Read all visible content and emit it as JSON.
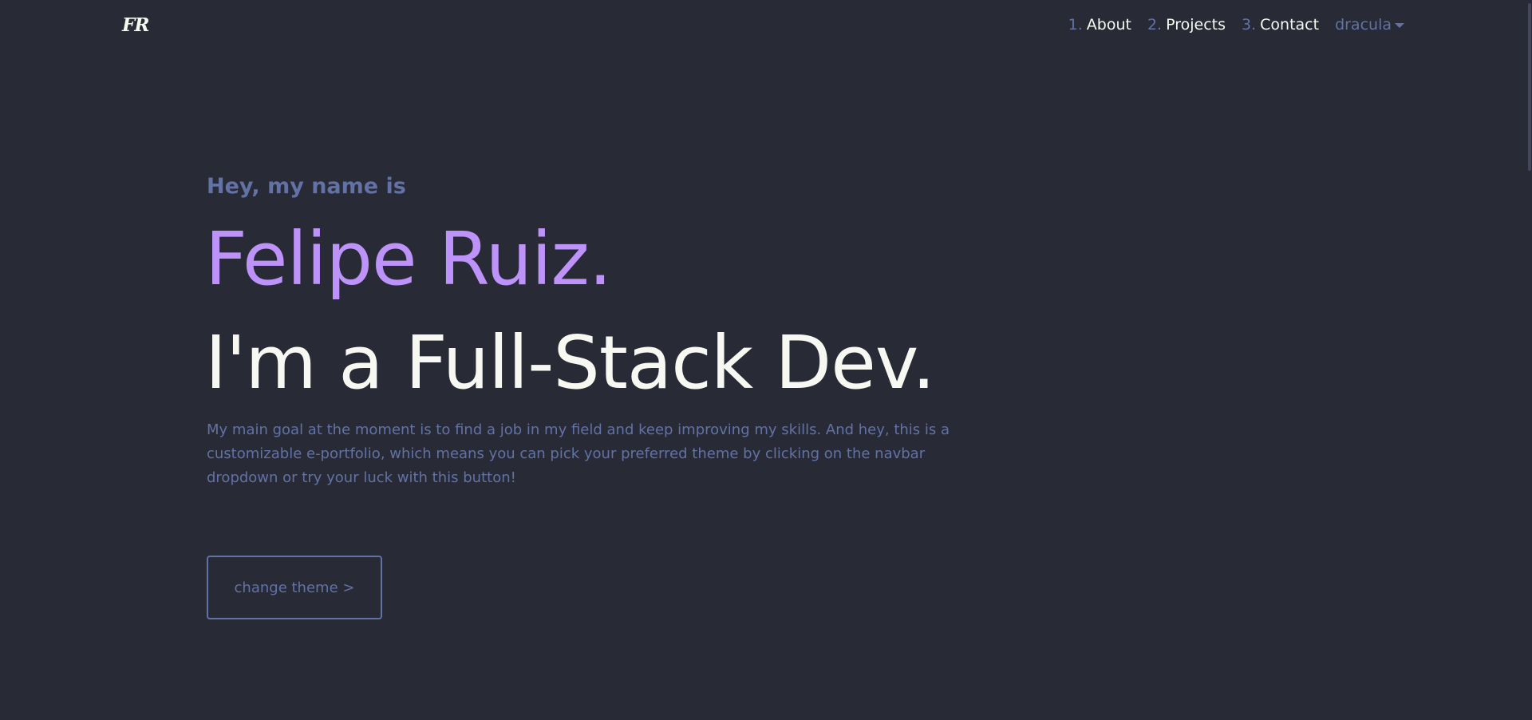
{
  "navbar": {
    "logo": "FR",
    "items": [
      {
        "num": "1.",
        "label": "About"
      },
      {
        "num": "2.",
        "label": "Projects"
      },
      {
        "num": "3.",
        "label": "Contact"
      }
    ],
    "theme_selected": "dracula"
  },
  "hero": {
    "greeting": "Hey, my name is",
    "name": "Felipe Ruiz.",
    "role": "I'm a Full-Stack Dev.",
    "description": "My main goal at the moment is to find a job in my field and keep improving my skills. And hey, this is a customizable e-portfolio, which means you can pick your preferred theme by clicking on the navbar dropdown or try your luck with this button!",
    "button_label": "change theme >"
  },
  "colors": {
    "background": "#282a36",
    "accent": "#bd93f9",
    "muted": "#6272a4",
    "foreground": "#f8f8f2"
  }
}
